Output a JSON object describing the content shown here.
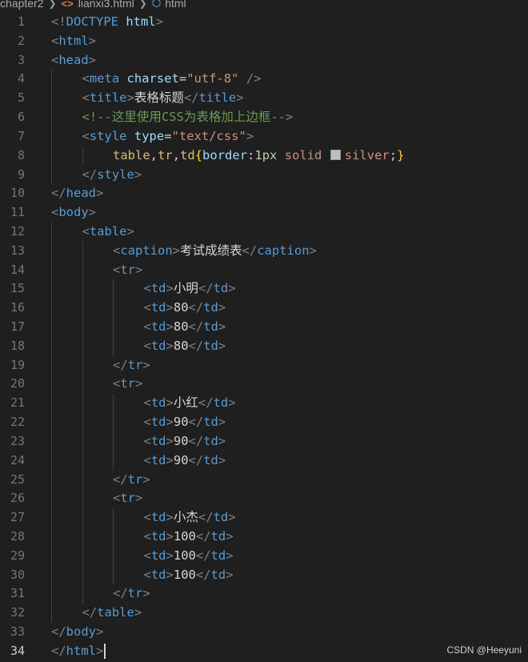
{
  "breadcrumb": {
    "folder": "chapter2",
    "file": "lianxi3.html",
    "symbol": "html"
  },
  "editor": {
    "active_line": 34,
    "lines": [
      {
        "n": 1,
        "indent": 0,
        "tokens": [
          [
            "punct",
            "<!"
          ],
          [
            "tag",
            "DOCTYPE"
          ],
          [
            "text",
            " "
          ],
          [
            "attr",
            "html"
          ],
          [
            "punct",
            ">"
          ]
        ]
      },
      {
        "n": 2,
        "indent": 0,
        "tokens": [
          [
            "punct",
            "<"
          ],
          [
            "tag",
            "html"
          ],
          [
            "punct",
            ">"
          ]
        ]
      },
      {
        "n": 3,
        "indent": 0,
        "tokens": [
          [
            "punct",
            "<"
          ],
          [
            "tag",
            "head"
          ],
          [
            "punct",
            ">"
          ]
        ]
      },
      {
        "n": 4,
        "indent": 1,
        "tokens": [
          [
            "punct",
            "<"
          ],
          [
            "tag",
            "meta"
          ],
          [
            "text",
            " "
          ],
          [
            "attr",
            "charset"
          ],
          [
            "text",
            "="
          ],
          [
            "str",
            "\"utf-8\""
          ],
          [
            "text",
            " "
          ],
          [
            "punct",
            "/>"
          ]
        ]
      },
      {
        "n": 5,
        "indent": 1,
        "tokens": [
          [
            "punct",
            "<"
          ],
          [
            "tag",
            "title"
          ],
          [
            "punct",
            ">"
          ],
          [
            "text",
            "表格标题"
          ],
          [
            "punct",
            "</"
          ],
          [
            "tag",
            "title"
          ],
          [
            "punct",
            ">"
          ]
        ]
      },
      {
        "n": 6,
        "indent": 1,
        "tokens": [
          [
            "comment",
            "<!--这里使用CSS为表格加上边框-->"
          ]
        ]
      },
      {
        "n": 7,
        "indent": 1,
        "tokens": [
          [
            "punct",
            "<"
          ],
          [
            "tag",
            "style"
          ],
          [
            "text",
            " "
          ],
          [
            "attr",
            "type"
          ],
          [
            "text",
            "="
          ],
          [
            "str",
            "\"text/css\""
          ],
          [
            "punct",
            ">"
          ]
        ]
      },
      {
        "n": 8,
        "indent": 2,
        "tokens": [
          [
            "sel",
            "table"
          ],
          [
            "text",
            ","
          ],
          [
            "sel",
            "tr"
          ],
          [
            "text",
            ","
          ],
          [
            "sel",
            "td"
          ],
          [
            "brace",
            "{"
          ],
          [
            "prop",
            "border"
          ],
          [
            "text",
            ":"
          ],
          [
            "num",
            "1px"
          ],
          [
            "text",
            " "
          ],
          [
            "val",
            "solid"
          ],
          [
            "text",
            " "
          ],
          [
            "swatch",
            ""
          ],
          [
            "val",
            "silver"
          ],
          [
            "text",
            ";"
          ],
          [
            "brace",
            "}"
          ]
        ]
      },
      {
        "n": 9,
        "indent": 1,
        "tokens": [
          [
            "punct",
            "</"
          ],
          [
            "tag",
            "style"
          ],
          [
            "punct",
            ">"
          ]
        ]
      },
      {
        "n": 10,
        "indent": 0,
        "tokens": [
          [
            "punct",
            "</"
          ],
          [
            "tag",
            "head"
          ],
          [
            "punct",
            ">"
          ]
        ]
      },
      {
        "n": 11,
        "indent": 0,
        "tokens": [
          [
            "punct",
            "<"
          ],
          [
            "tag",
            "body"
          ],
          [
            "punct",
            ">"
          ]
        ]
      },
      {
        "n": 12,
        "indent": 1,
        "tokens": [
          [
            "punct",
            "<"
          ],
          [
            "tag",
            "table"
          ],
          [
            "punct",
            ">"
          ]
        ]
      },
      {
        "n": 13,
        "indent": 2,
        "tokens": [
          [
            "punct",
            "<"
          ],
          [
            "tag",
            "caption"
          ],
          [
            "punct",
            ">"
          ],
          [
            "text",
            "考试成绩表"
          ],
          [
            "punct",
            "</"
          ],
          [
            "tag",
            "caption"
          ],
          [
            "punct",
            ">"
          ]
        ]
      },
      {
        "n": 14,
        "indent": 2,
        "tokens": [
          [
            "punct",
            "<"
          ],
          [
            "tag",
            "tr"
          ],
          [
            "punct",
            ">"
          ]
        ]
      },
      {
        "n": 15,
        "indent": 3,
        "tokens": [
          [
            "punct",
            "<"
          ],
          [
            "tag",
            "td"
          ],
          [
            "punct",
            ">"
          ],
          [
            "text",
            "小明"
          ],
          [
            "punct",
            "</"
          ],
          [
            "tag",
            "td"
          ],
          [
            "punct",
            ">"
          ]
        ]
      },
      {
        "n": 16,
        "indent": 3,
        "tokens": [
          [
            "punct",
            "<"
          ],
          [
            "tag",
            "td"
          ],
          [
            "punct",
            ">"
          ],
          [
            "text",
            "80"
          ],
          [
            "punct",
            "</"
          ],
          [
            "tag",
            "td"
          ],
          [
            "punct",
            ">"
          ]
        ]
      },
      {
        "n": 17,
        "indent": 3,
        "tokens": [
          [
            "punct",
            "<"
          ],
          [
            "tag",
            "td"
          ],
          [
            "punct",
            ">"
          ],
          [
            "text",
            "80"
          ],
          [
            "punct",
            "</"
          ],
          [
            "tag",
            "td"
          ],
          [
            "punct",
            ">"
          ]
        ]
      },
      {
        "n": 18,
        "indent": 3,
        "tokens": [
          [
            "punct",
            "<"
          ],
          [
            "tag",
            "td"
          ],
          [
            "punct",
            ">"
          ],
          [
            "text",
            "80"
          ],
          [
            "punct",
            "</"
          ],
          [
            "tag",
            "td"
          ],
          [
            "punct",
            ">"
          ]
        ]
      },
      {
        "n": 19,
        "indent": 2,
        "tokens": [
          [
            "punct",
            "</"
          ],
          [
            "tag",
            "tr"
          ],
          [
            "punct",
            ">"
          ]
        ]
      },
      {
        "n": 20,
        "indent": 2,
        "tokens": [
          [
            "punct",
            "<"
          ],
          [
            "tag",
            "tr"
          ],
          [
            "punct",
            ">"
          ]
        ]
      },
      {
        "n": 21,
        "indent": 3,
        "tokens": [
          [
            "punct",
            "<"
          ],
          [
            "tag",
            "td"
          ],
          [
            "punct",
            ">"
          ],
          [
            "text",
            "小红"
          ],
          [
            "punct",
            "</"
          ],
          [
            "tag",
            "td"
          ],
          [
            "punct",
            ">"
          ]
        ]
      },
      {
        "n": 22,
        "indent": 3,
        "tokens": [
          [
            "punct",
            "<"
          ],
          [
            "tag",
            "td"
          ],
          [
            "punct",
            ">"
          ],
          [
            "text",
            "90"
          ],
          [
            "punct",
            "</"
          ],
          [
            "tag",
            "td"
          ],
          [
            "punct",
            ">"
          ]
        ]
      },
      {
        "n": 23,
        "indent": 3,
        "tokens": [
          [
            "punct",
            "<"
          ],
          [
            "tag",
            "td"
          ],
          [
            "punct",
            ">"
          ],
          [
            "text",
            "90"
          ],
          [
            "punct",
            "</"
          ],
          [
            "tag",
            "td"
          ],
          [
            "punct",
            ">"
          ]
        ]
      },
      {
        "n": 24,
        "indent": 3,
        "tokens": [
          [
            "punct",
            "<"
          ],
          [
            "tag",
            "td"
          ],
          [
            "punct",
            ">"
          ],
          [
            "text",
            "90"
          ],
          [
            "punct",
            "</"
          ],
          [
            "tag",
            "td"
          ],
          [
            "punct",
            ">"
          ]
        ]
      },
      {
        "n": 25,
        "indent": 2,
        "tokens": [
          [
            "punct",
            "</"
          ],
          [
            "tag",
            "tr"
          ],
          [
            "punct",
            ">"
          ]
        ]
      },
      {
        "n": 26,
        "indent": 2,
        "tokens": [
          [
            "punct",
            "<"
          ],
          [
            "tag",
            "tr"
          ],
          [
            "punct",
            ">"
          ]
        ]
      },
      {
        "n": 27,
        "indent": 3,
        "tokens": [
          [
            "punct",
            "<"
          ],
          [
            "tag",
            "td"
          ],
          [
            "punct",
            ">"
          ],
          [
            "text",
            "小杰"
          ],
          [
            "punct",
            "</"
          ],
          [
            "tag",
            "td"
          ],
          [
            "punct",
            ">"
          ]
        ]
      },
      {
        "n": 28,
        "indent": 3,
        "tokens": [
          [
            "punct",
            "<"
          ],
          [
            "tag",
            "td"
          ],
          [
            "punct",
            ">"
          ],
          [
            "text",
            "100"
          ],
          [
            "punct",
            "</"
          ],
          [
            "tag",
            "td"
          ],
          [
            "punct",
            ">"
          ]
        ]
      },
      {
        "n": 29,
        "indent": 3,
        "tokens": [
          [
            "punct",
            "<"
          ],
          [
            "tag",
            "td"
          ],
          [
            "punct",
            ">"
          ],
          [
            "text",
            "100"
          ],
          [
            "punct",
            "</"
          ],
          [
            "tag",
            "td"
          ],
          [
            "punct",
            ">"
          ]
        ]
      },
      {
        "n": 30,
        "indent": 3,
        "tokens": [
          [
            "punct",
            "<"
          ],
          [
            "tag",
            "td"
          ],
          [
            "punct",
            ">"
          ],
          [
            "text",
            "100"
          ],
          [
            "punct",
            "</"
          ],
          [
            "tag",
            "td"
          ],
          [
            "punct",
            ">"
          ]
        ]
      },
      {
        "n": 31,
        "indent": 2,
        "tokens": [
          [
            "punct",
            "</"
          ],
          [
            "tag",
            "tr"
          ],
          [
            "punct",
            ">"
          ]
        ]
      },
      {
        "n": 32,
        "indent": 1,
        "tokens": [
          [
            "punct",
            "</"
          ],
          [
            "tag",
            "table"
          ],
          [
            "punct",
            ">"
          ]
        ]
      },
      {
        "n": 33,
        "indent": 0,
        "tokens": [
          [
            "punct",
            "</"
          ],
          [
            "tag",
            "body"
          ],
          [
            "punct",
            ">"
          ]
        ]
      },
      {
        "n": 34,
        "indent": 0,
        "tokens": [
          [
            "punct",
            "</"
          ],
          [
            "tag",
            "html"
          ],
          [
            "punct",
            ">"
          ]
        ]
      }
    ]
  },
  "swatch_color": "#c0c0c0",
  "watermark": "CSDN @Heeyuni"
}
